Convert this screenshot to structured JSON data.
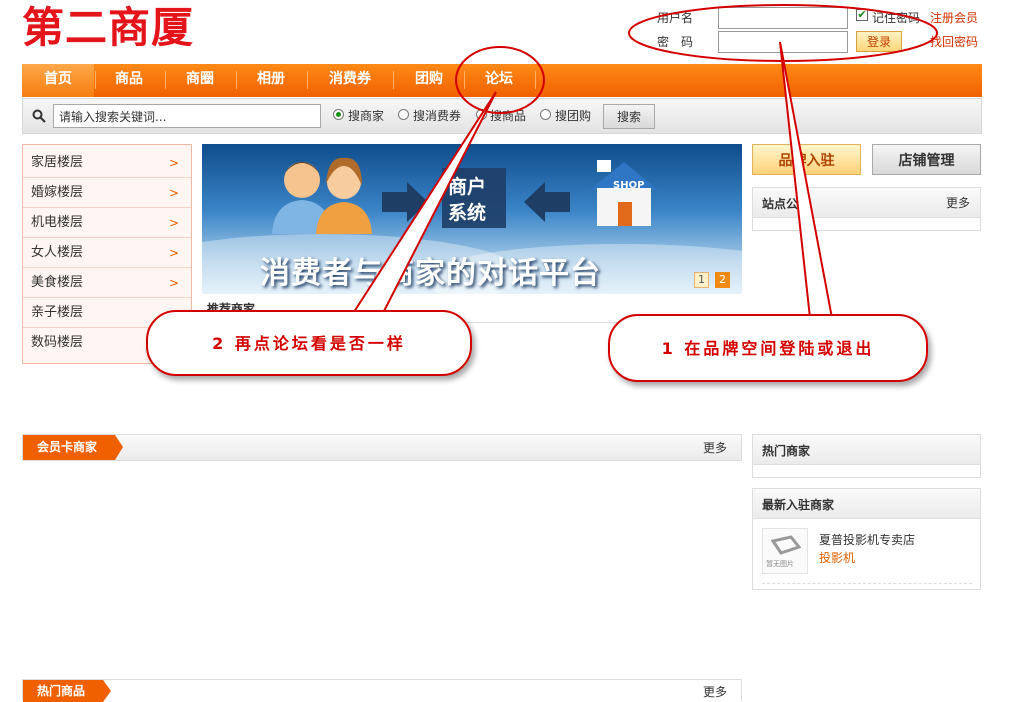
{
  "logo": "第二商厦",
  "login": {
    "username_label": "用户名",
    "password_label": "密　码",
    "remember_label": "记住密码",
    "login_button": "登录",
    "register_link": "注册会员",
    "recover_link": "找回密码"
  },
  "nav": {
    "items": [
      {
        "label": "首页"
      },
      {
        "label": "商品"
      },
      {
        "label": "商圈"
      },
      {
        "label": "相册"
      },
      {
        "label": "消费券"
      },
      {
        "label": "团购"
      },
      {
        "label": "论坛"
      }
    ]
  },
  "search": {
    "placeholder": "请输入搜索关键词...",
    "options": [
      {
        "label": "搜商家",
        "checked": true
      },
      {
        "label": "搜消费券",
        "checked": false
      },
      {
        "label": "搜商品",
        "checked": false
      },
      {
        "label": "搜团购",
        "checked": false
      }
    ],
    "button": "搜索"
  },
  "floors": [
    {
      "label": "家居楼层",
      "arrow": ">"
    },
    {
      "label": "婚嫁楼层",
      "arrow": ">"
    },
    {
      "label": "机电楼层",
      "arrow": ">"
    },
    {
      "label": "女人楼层",
      "arrow": ">"
    },
    {
      "label": "美食楼层",
      "arrow": ">"
    },
    {
      "label": "亲子楼层",
      "arrow": ""
    },
    {
      "label": "数码楼层",
      "arrow": ""
    }
  ],
  "banner": {
    "system_line1": "商户",
    "system_line2": "系统",
    "shop_label": "SHOP",
    "slogan": "消费者与商家的对话平台",
    "pages": [
      "1",
      "2"
    ]
  },
  "recommend_title": "推荐商家",
  "side_buttons": {
    "brand_join": "品牌入驻",
    "shop_manage": "店铺管理"
  },
  "notice": {
    "title": "站点公告",
    "more": "更多"
  },
  "member_card": {
    "title": "会员卡商家",
    "more": "更多"
  },
  "hot_merchants": {
    "title": "热门商家"
  },
  "new_merchants": {
    "title": "最新入驻商家",
    "items": [
      {
        "name": "夏普投影机专卖店",
        "category": "投影机",
        "thumb_text": "暂无图片"
      }
    ]
  },
  "hot_goods": {
    "title": "热门商品",
    "more": "更多"
  },
  "callouts": {
    "callout_1": "1 在品牌空间登陆或退出",
    "callout_2": "2 再点论坛看是否一样"
  },
  "colors": {
    "accent": "#f06000",
    "logo": "#e4141b",
    "annotation": "#d40000"
  }
}
